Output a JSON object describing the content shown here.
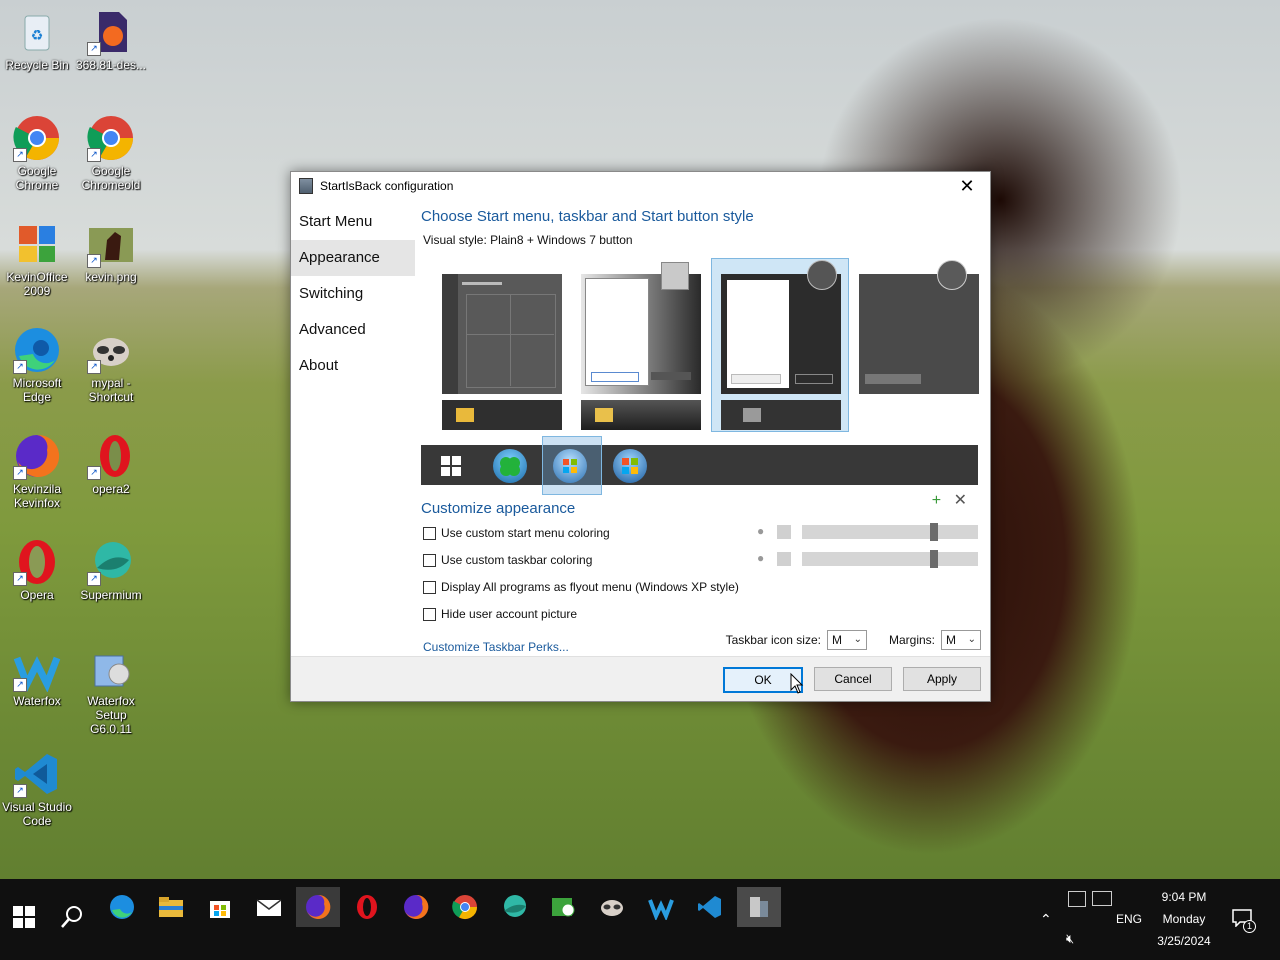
{
  "desktop": {
    "icons": [
      {
        "label": "Recycle Bin"
      },
      {
        "label": "368.81-des..."
      },
      {
        "label": "Google Chrome"
      },
      {
        "label": "Google Chromeold"
      },
      {
        "label": "KevinOffice 2009"
      },
      {
        "label": "kevin.png"
      },
      {
        "label": "Microsoft Edge"
      },
      {
        "label": "mypal - Shortcut"
      },
      {
        "label": "Kevinzila Kevinfox"
      },
      {
        "label": "opera2"
      },
      {
        "label": "Opera"
      },
      {
        "label": "Supermium"
      },
      {
        "label": "Waterfox"
      },
      {
        "label": "Waterfox Setup G6.0.11"
      },
      {
        "label": "Visual Studio Code"
      }
    ]
  },
  "dialog": {
    "title": "StartIsBack configuration",
    "nav": [
      "Start Menu",
      "Appearance",
      "Switching",
      "Advanced",
      "About"
    ],
    "active_nav": "Appearance",
    "heading": "Choose Start menu, taskbar and Start button style",
    "visual_style": "Visual style:  Plain8 + Windows 7 button",
    "customize_heading": "Customize appearance",
    "options": [
      {
        "label": "Use custom start menu coloring",
        "checked": false
      },
      {
        "label": "Use custom taskbar coloring",
        "checked": false
      },
      {
        "label": "Display All programs as flyout menu (Windows XP style)",
        "checked": false
      },
      {
        "label": "Hide user account picture",
        "checked": false
      }
    ],
    "slider_levels": [
      0.75,
      0.75
    ],
    "link": "Customize Taskbar Perks...",
    "icon_size_label": "Taskbar icon size:",
    "icon_size_value": "M",
    "margins_label": "Margins:",
    "margins_value": "M",
    "buttons": {
      "ok": "OK",
      "cancel": "Cancel",
      "apply": "Apply"
    },
    "accent": "#1a5a9c"
  },
  "taskbar": {
    "time": "9:04 PM",
    "day": "Monday",
    "date": "3/25/2024",
    "lang": "ENG",
    "notification_count": "1"
  }
}
